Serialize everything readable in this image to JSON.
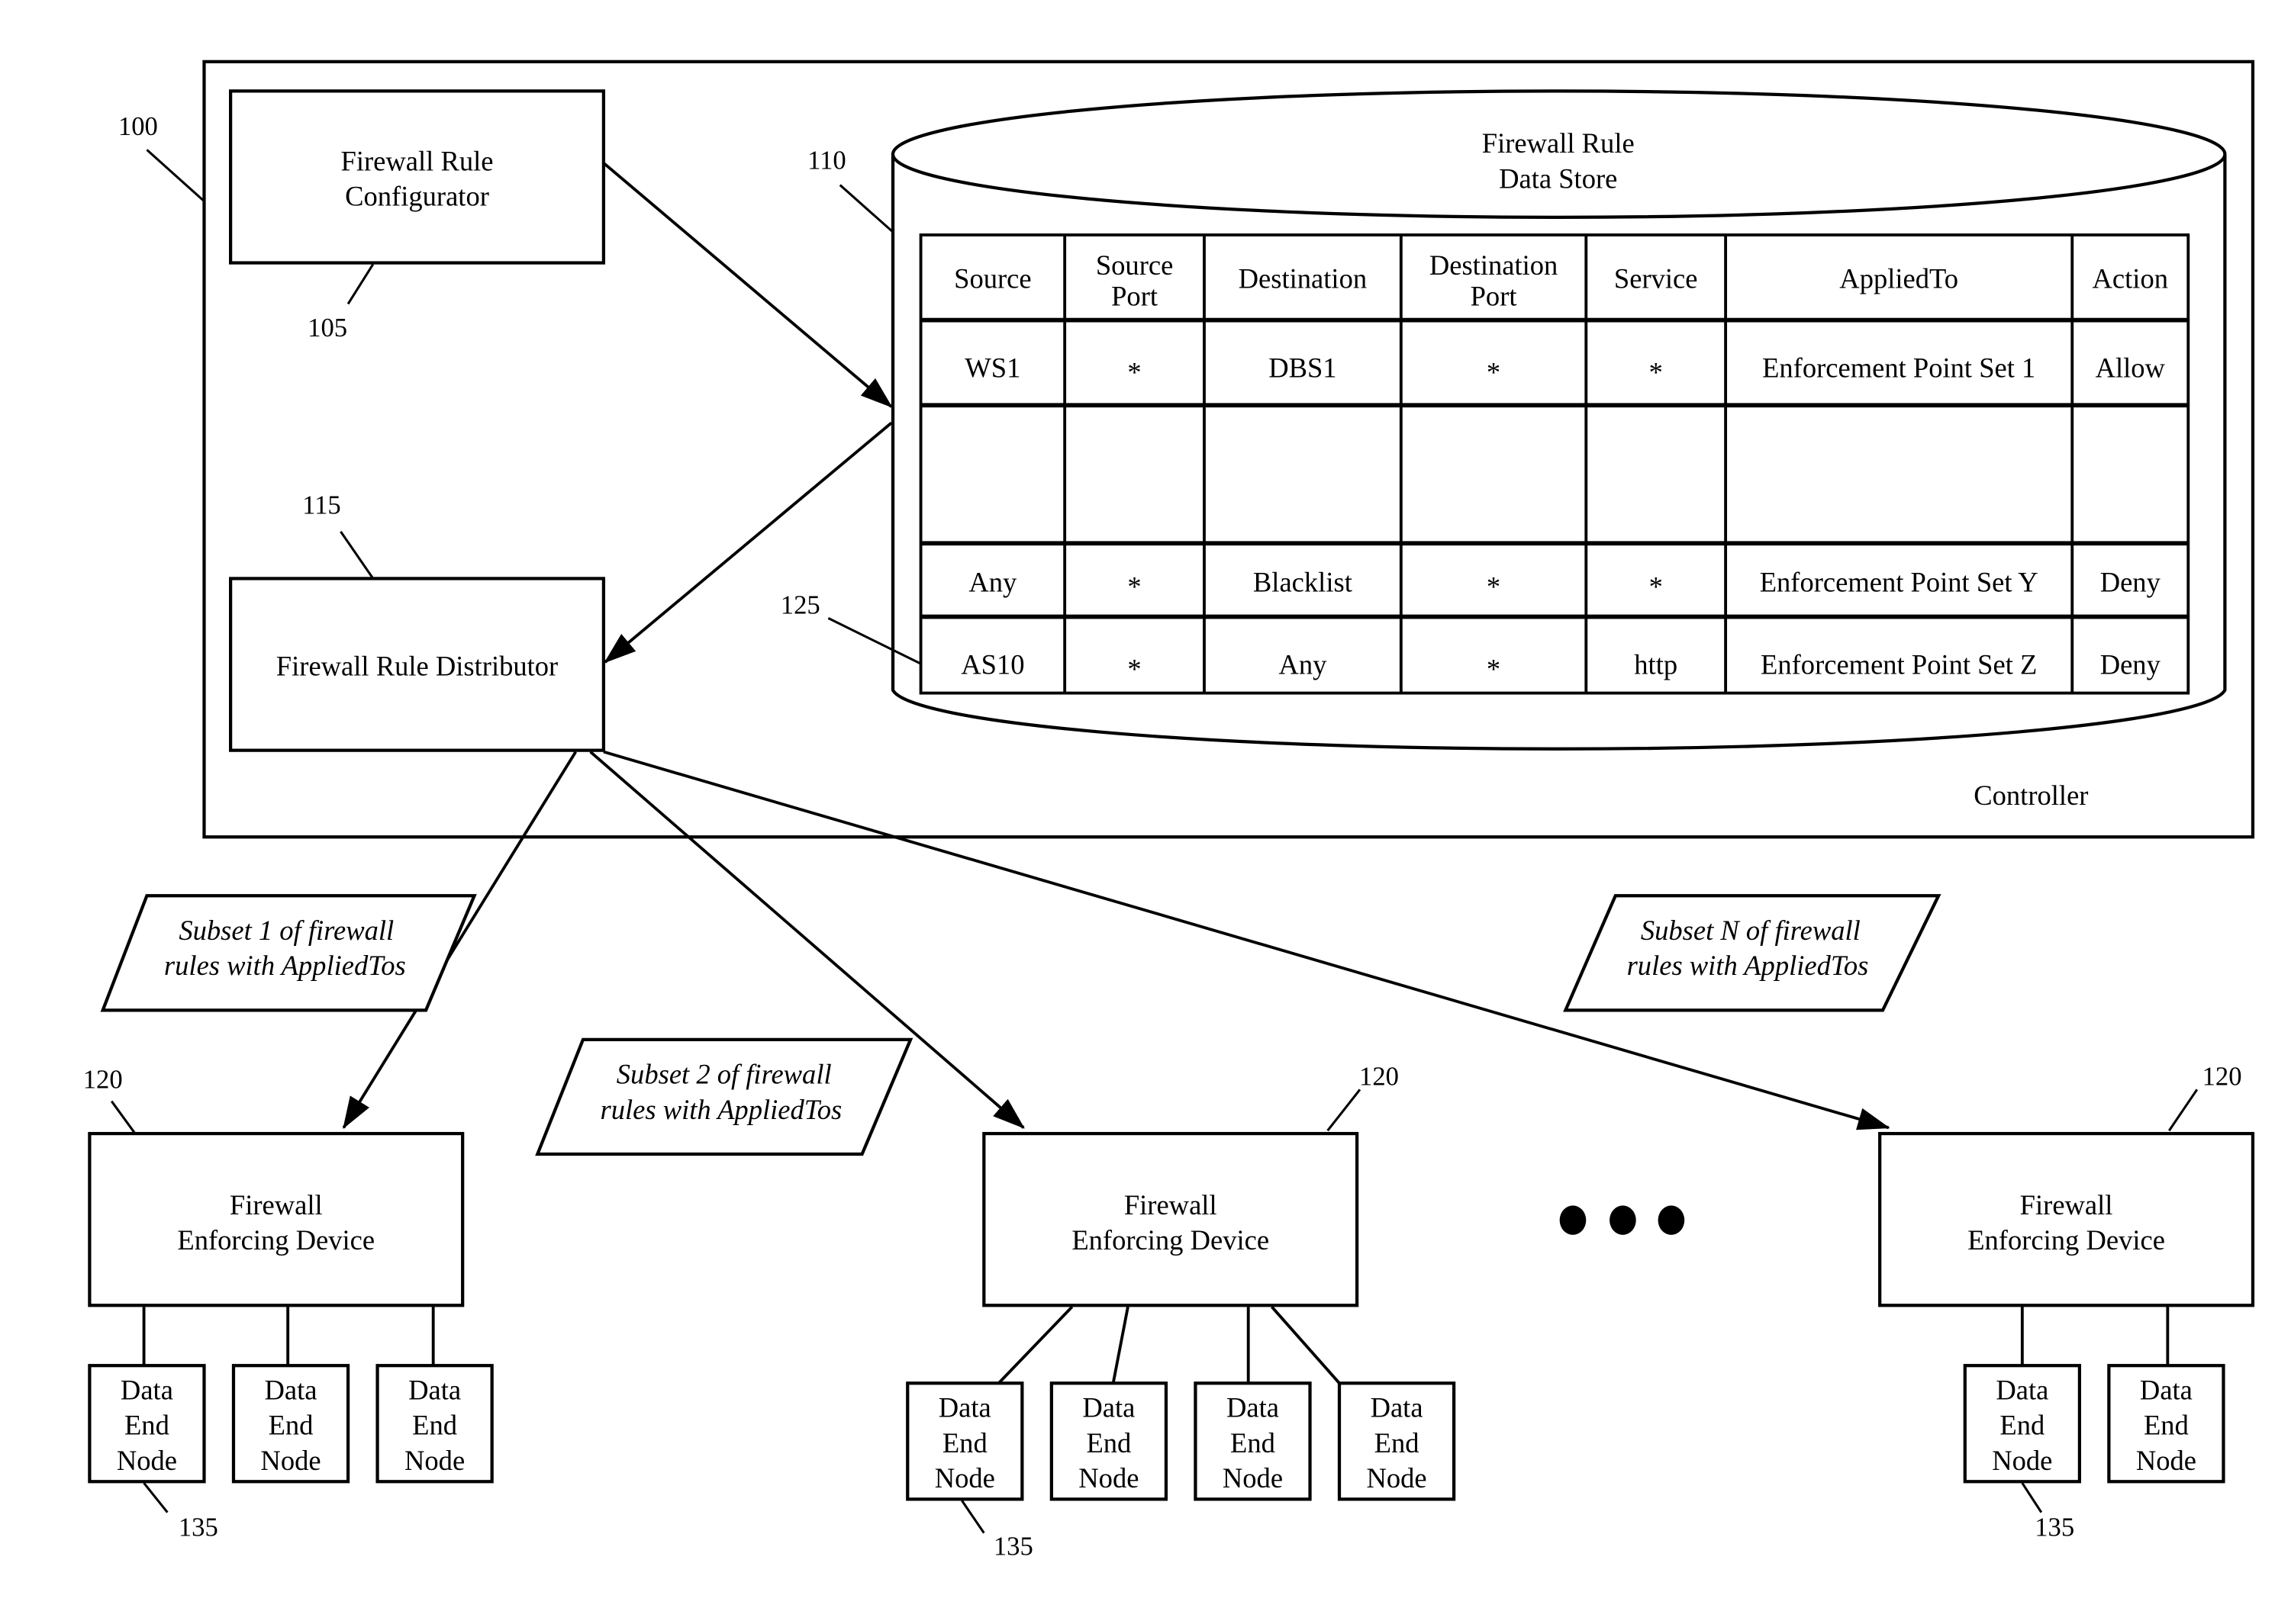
{
  "controller": {
    "label": "Controller",
    "ref": "100"
  },
  "configurator": {
    "line1": "Firewall Rule",
    "line2": "Configurator",
    "ref": "105"
  },
  "distributor": {
    "label": "Firewall Rule Distributor",
    "ref": "115"
  },
  "data_store": {
    "line1": "Firewall Rule",
    "line2": "Data Store",
    "ref": "110",
    "row_ref": "125",
    "columns": [
      {
        "line1": "Source",
        "line2": ""
      },
      {
        "line1": "Source",
        "line2": "Port"
      },
      {
        "line1": "Destination",
        "line2": ""
      },
      {
        "line1": "Destination",
        "line2": "Port"
      },
      {
        "line1": "Service",
        "line2": ""
      },
      {
        "line1": "AppliedTo",
        "line2": ""
      },
      {
        "line1": "Action",
        "line2": ""
      }
    ],
    "rows": [
      [
        "WS1",
        "*",
        "DBS1",
        "*",
        "*",
        "Enforcement Point Set 1",
        "Allow"
      ],
      [
        "",
        "",
        "",
        "",
        "",
        "",
        ""
      ],
      [
        "Any",
        "*",
        "Blacklist",
        "*",
        "*",
        "Enforcement Point Set Y",
        "Deny"
      ],
      [
        "AS10",
        "*",
        "Any",
        "*",
        "http",
        "Enforcement Point Set Z",
        "Deny"
      ]
    ]
  },
  "subsets": [
    {
      "line1": "Subset 1 of firewall",
      "line2": "rules with AppliedTos"
    },
    {
      "line1": "Subset 2 of firewall",
      "line2": "rules with AppliedTos"
    },
    {
      "line1": "Subset N of firewall",
      "line2": "rules with AppliedTos"
    }
  ],
  "devices": [
    {
      "line1": "Firewall",
      "line2": "Enforcing Device",
      "ref": "120",
      "node_ref": "135",
      "node_count": 3
    },
    {
      "line1": "Firewall",
      "line2": "Enforcing Device",
      "ref": "120",
      "node_ref": "135",
      "node_count": 4
    },
    {
      "line1": "Firewall",
      "line2": "Enforcing Device",
      "ref": "120",
      "node_ref": "135",
      "node_count": 2
    }
  ],
  "node": {
    "line1": "Data",
    "line2": "End",
    "line3": "Node"
  },
  "ellipsis": "•••"
}
